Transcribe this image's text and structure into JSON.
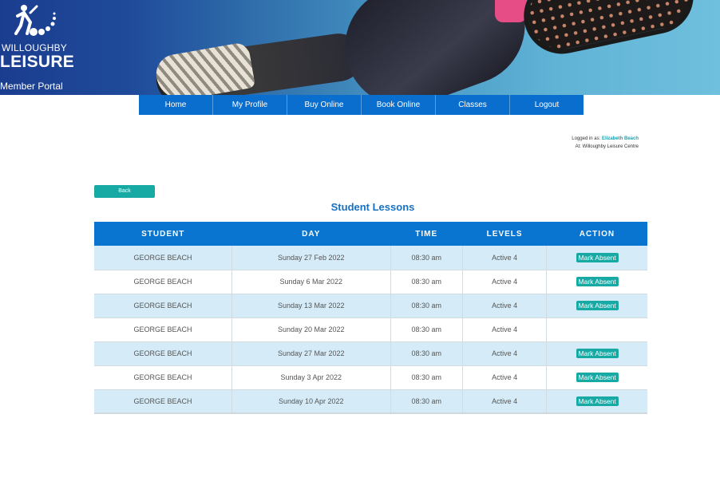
{
  "brand": {
    "top": "WILLOUGHBY",
    "main": "LEISURE",
    "portal": "Member Portal"
  },
  "nav": {
    "items": [
      "Home",
      "My Profile",
      "Buy Online",
      "Book Online",
      "Classes",
      "Logout"
    ]
  },
  "login": {
    "prefix": "Logged in as:",
    "user": "Elizabeth Beach",
    "location": "At: Willoughby Leisure Centre"
  },
  "back_label": "Back",
  "title": "Student Lessons",
  "table": {
    "headers": [
      "STUDENT",
      "DAY",
      "TIME",
      "LEVELS",
      "ACTION"
    ],
    "rows": [
      {
        "student": "GEORGE BEACH",
        "day": "Sunday 27 Feb 2022",
        "time": "08:30 am",
        "level": "Active 4",
        "action": "Mark Absent"
      },
      {
        "student": "GEORGE BEACH",
        "day": "Sunday 6 Mar 2022",
        "time": "08:30 am",
        "level": "Active 4",
        "action": "Mark Absent"
      },
      {
        "student": "GEORGE BEACH",
        "day": "Sunday 13 Mar 2022",
        "time": "08:30 am",
        "level": "Active 4",
        "action": "Mark Absent"
      },
      {
        "student": "GEORGE BEACH",
        "day": "Sunday 20 Mar 2022",
        "time": "08:30 am",
        "level": "Active 4",
        "action": ""
      },
      {
        "student": "GEORGE BEACH",
        "day": "Sunday 27 Mar 2022",
        "time": "08:30 am",
        "level": "Active 4",
        "action": "Mark Absent"
      },
      {
        "student": "GEORGE BEACH",
        "day": "Sunday 3 Apr 2022",
        "time": "08:30 am",
        "level": "Active 4",
        "action": "Mark Absent"
      },
      {
        "student": "GEORGE BEACH",
        "day": "Sunday 10 Apr 2022",
        "time": "08:30 am",
        "level": "Active 4",
        "action": "Mark Absent"
      }
    ]
  },
  "colors": {
    "nav": "#0a6ecf",
    "accent_teal": "#17a9a4",
    "title_blue": "#1670c4",
    "row_alt": "#d5ecf8"
  }
}
